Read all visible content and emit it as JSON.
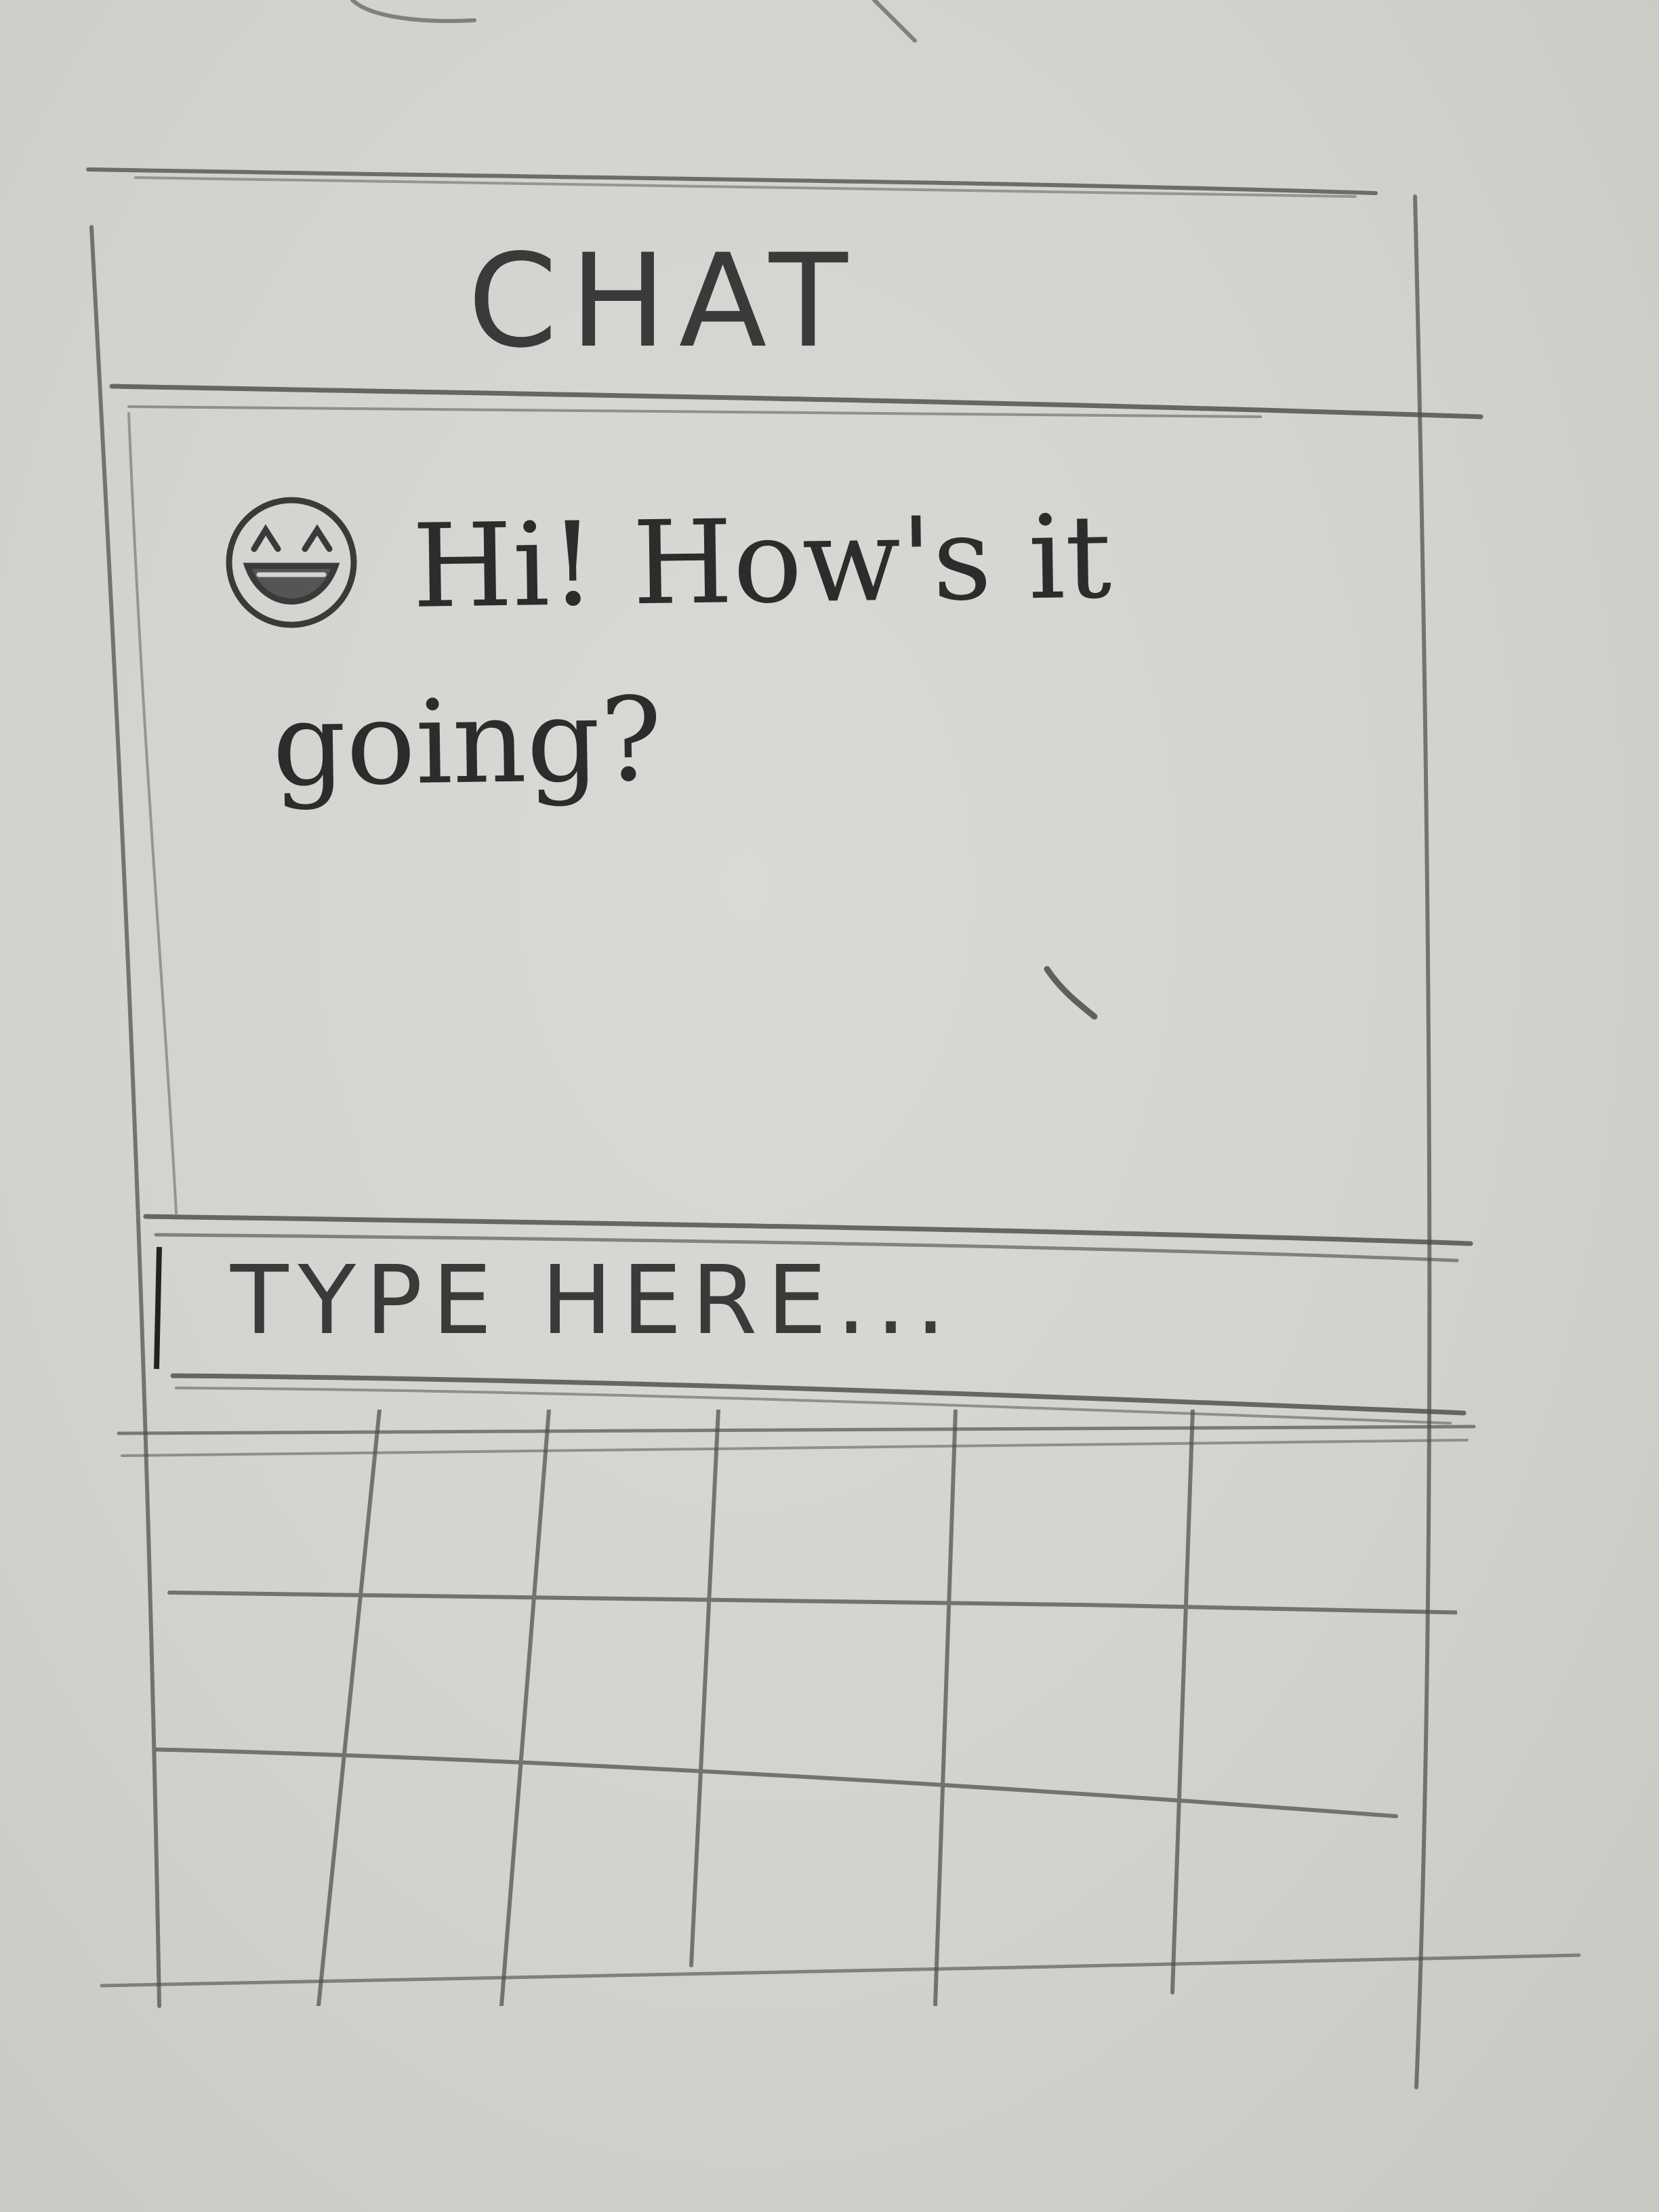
{
  "header": {
    "title": "CHAT"
  },
  "messages": [
    {
      "avatar_icon": "laughing-face-icon",
      "text": "Hi! How's it going?"
    }
  ],
  "composer": {
    "placeholder": "TYPE HERE..."
  },
  "keyboard": {
    "rows": 3,
    "columns": 6
  },
  "colors": {
    "paper": "#d4d4d0",
    "pencil": "#4a4a4a"
  }
}
